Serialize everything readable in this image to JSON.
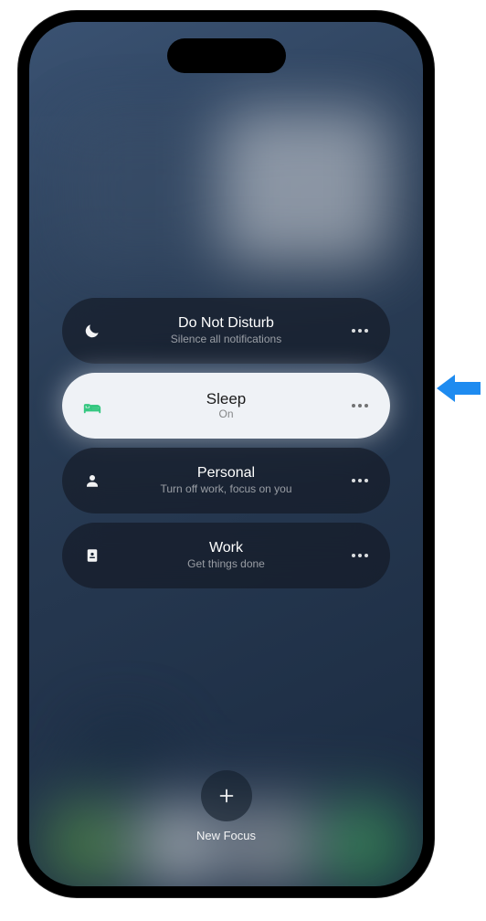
{
  "focus_modes": [
    {
      "title": "Do Not Disturb",
      "subtitle": "Silence all notifications",
      "active": false
    },
    {
      "title": "Sleep",
      "subtitle": "On",
      "active": true
    },
    {
      "title": "Personal",
      "subtitle": "Turn off work, focus on you",
      "active": false
    },
    {
      "title": "Work",
      "subtitle": "Get things done",
      "active": false
    }
  ],
  "new_focus_label": "New Focus"
}
